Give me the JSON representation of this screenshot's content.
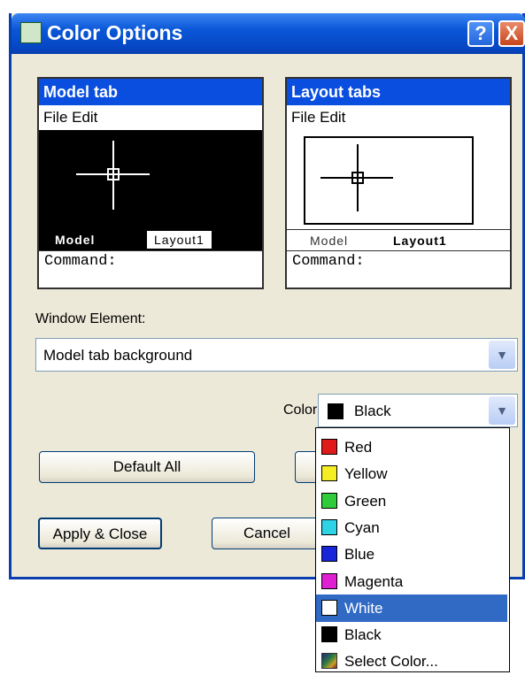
{
  "window": {
    "title": "Color Options",
    "help_glyph": "?",
    "close_glyph": "X",
    "title_icon": "color-options-icon"
  },
  "model_preview": {
    "header": "Model tab",
    "menu": "File  Edit",
    "background": "#000000",
    "tabs": [
      "Model",
      "Layout1"
    ],
    "command": "Command:"
  },
  "layout_preview": {
    "header": "Layout tabs",
    "menu": "File  Edit",
    "tabs": [
      "Model",
      "Layout1"
    ],
    "command": "Command:"
  },
  "window_element": {
    "label": "Window Element:",
    "value": "Model tab background"
  },
  "color": {
    "label": "Color:",
    "value": "Black",
    "value_color": "#000000"
  },
  "buttons": {
    "default_all": "Default All",
    "apply_close": "Apply & Close",
    "cancel": "Cancel"
  },
  "dropdown": {
    "options": [
      {
        "label": "Red",
        "color": "#e0191b"
      },
      {
        "label": "Yellow",
        "color": "#f5ee24"
      },
      {
        "label": "Green",
        "color": "#2ecc3a"
      },
      {
        "label": "Cyan",
        "color": "#2ed3e6"
      },
      {
        "label": "Blue",
        "color": "#1626d8"
      },
      {
        "label": "Magenta",
        "color": "#e01ed2"
      },
      {
        "label": "White",
        "color": "#ffffff"
      },
      {
        "label": "Black",
        "color": "#000000"
      },
      {
        "label": "Select Color...",
        "color": "select-color-icon"
      }
    ],
    "selected": "White"
  }
}
